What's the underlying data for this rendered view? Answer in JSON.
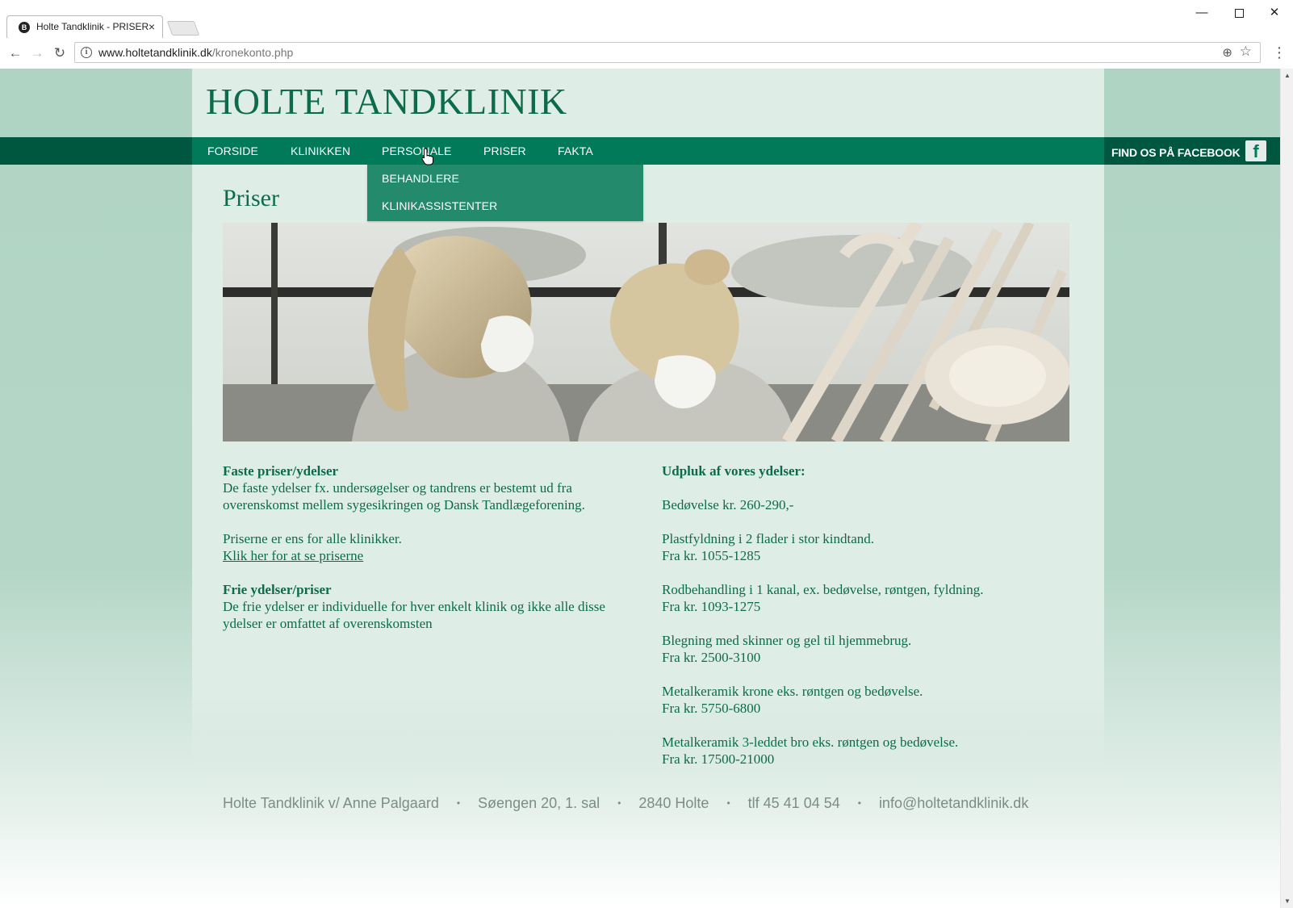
{
  "browser": {
    "tab_title": "Holte Tandklinik - PRISER",
    "tab_favicon_letter": "B",
    "url_host": "www.holtetandklinik.dk",
    "url_path": "/kronekonto.php"
  },
  "site": {
    "logo": "HOLTE TANDKLINIK",
    "nav": [
      "FORSIDE",
      "KLINIKKEN",
      "PERSONALE",
      "PRISER",
      "FAKTA"
    ],
    "facebook_label": "FIND OS PÅ FACEBOOK",
    "dropdown": [
      "BEHANDLERE",
      "KLINIKASSISTENTER"
    ],
    "accent_color": "#017a59",
    "nav_bg_color": "#00573f"
  },
  "page": {
    "title": "Priser",
    "left": {
      "fixed_heading": "Faste priser/ydelser",
      "fixed_line1": "De faste ydelser fx. undersøgelser og tandrens er bestemt ud fra",
      "fixed_line2": "overenskomst mellem sygesikringen og Dansk Tandlægeforening.",
      "same_prices": "Priserne er ens for alle klinikker.",
      "prices_link": "Klik her for at se priserne",
      "free_heading": "Frie ydelser/priser",
      "free_line1": "De frie ydelser er individuelle for hver enkelt klinik og ikke alle disse",
      "free_line2": "ydelser er omfattet af overenskomsten"
    },
    "right": {
      "heading": "Udpluk af vores ydelser:",
      "anesthesia": "Bedøvelse kr. 260-290,-",
      "services": [
        {
          "name": "Plastfyldning i 2 flader i stor kindtand.",
          "price": "Fra kr. 1055-1285"
        },
        {
          "name": "Rodbehandling i 1 kanal, ex. bedøvelse, røntgen, fyldning.",
          "price": "Fra kr. 1093-1275"
        },
        {
          "name": "Blegning med skinner og gel til hjemmebrug.",
          "price": "Fra kr. 2500-3100"
        },
        {
          "name": "Metalkeramik krone eks. røntgen og bedøvelse.",
          "price": "Fra kr. 5750-6800"
        },
        {
          "name": "Metalkeramik 3-leddet bro eks. røntgen og bedøvelse.",
          "price": "Fra kr. 17500-21000"
        }
      ]
    }
  },
  "footer": {
    "name": "Holte Tandklinik v/ Anne Palgaard",
    "address": "Søengen 20, 1. sal",
    "city": "2840 Holte",
    "phone": "tlf 45 41 04 54",
    "email": "info@holtetandklinik.dk",
    "separator": "•"
  }
}
